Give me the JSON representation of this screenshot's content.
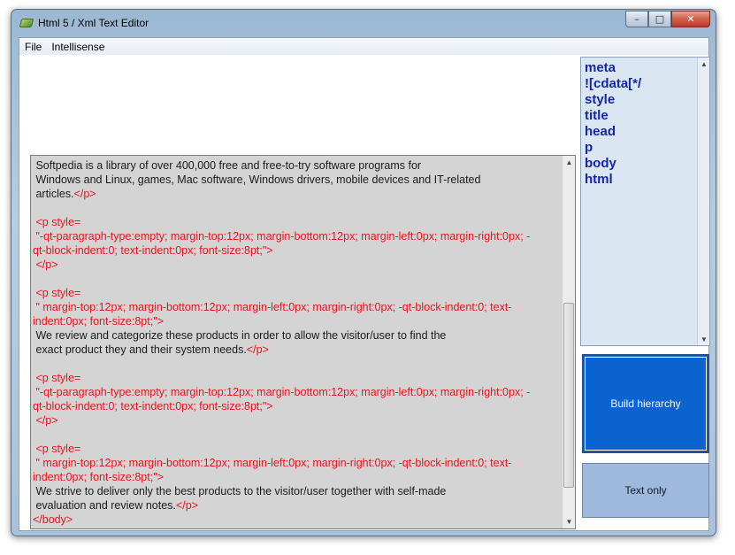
{
  "window": {
    "title": "Html 5 / Xml Text Editor",
    "caption_buttons": {
      "minimize": "–",
      "maximize": "□",
      "close": "✕"
    }
  },
  "menu": [
    "File",
    "Intellisense"
  ],
  "editor": {
    "lines": [
      [
        {
          "t": " Softpedia is a library of over 400,000 free and free-to-try software programs for",
          "c": "blk"
        }
      ],
      [
        {
          "t": " Windows and Linux, games, Mac software, Windows drivers, mobile devices and IT-related",
          "c": "blk"
        }
      ],
      [
        {
          "t": " articles.",
          "c": "blk"
        },
        {
          "t": "</p>",
          "c": "red"
        }
      ],
      [],
      [
        {
          "t": " <p style=",
          "c": "red"
        }
      ],
      [
        {
          "t": " \"-qt-paragraph-type:empty; margin-top:12px; margin-bottom:12px; margin-left:0px; margin-right:0px; -",
          "c": "red"
        }
      ],
      [
        {
          "t": "qt-block-indent:0; text-indent:0px; font-size:8pt;\">",
          "c": "red"
        }
      ],
      [
        {
          "t": " </p>",
          "c": "red"
        }
      ],
      [],
      [
        {
          "t": " <p style=",
          "c": "red"
        }
      ],
      [
        {
          "t": " \" margin-top:12px; margin-bottom:12px; margin-left:0px; margin-right:0px; -qt-block-indent:0; text-",
          "c": "red"
        }
      ],
      [
        {
          "t": "indent:0px; font-size:8pt;\">",
          "c": "red"
        }
      ],
      [
        {
          "t": " We review and categorize these products in order to allow the visitor/user to find the",
          "c": "blk"
        }
      ],
      [
        {
          "t": " exact product they and their system needs.",
          "c": "blk"
        },
        {
          "t": "</p>",
          "c": "red"
        }
      ],
      [],
      [
        {
          "t": " <p style=",
          "c": "red"
        }
      ],
      [
        {
          "t": " \"-qt-paragraph-type:empty; margin-top:12px; margin-bottom:12px; margin-left:0px; margin-right:0px; -",
          "c": "red"
        }
      ],
      [
        {
          "t": "qt-block-indent:0; text-indent:0px; font-size:8pt;\">",
          "c": "red"
        }
      ],
      [
        {
          "t": " </p>",
          "c": "red"
        }
      ],
      [],
      [
        {
          "t": " <p style=",
          "c": "red"
        }
      ],
      [
        {
          "t": " \" margin-top:12px; margin-bottom:12px; margin-left:0px; margin-right:0px; -qt-block-indent:0; text-",
          "c": "red"
        }
      ],
      [
        {
          "t": "indent:0px; font-size:8pt;\">",
          "c": "red"
        }
      ],
      [
        {
          "t": " We strive to deliver only the best products to the visitor/user together with self-made",
          "c": "blk"
        }
      ],
      [
        {
          "t": " evaluation and review notes.",
          "c": "blk"
        },
        {
          "t": "</p>",
          "c": "red"
        }
      ],
      [
        {
          "t": "</body>",
          "c": "red"
        }
      ]
    ]
  },
  "tags": [
    "meta",
    "![cdata[*/",
    "style",
    "title",
    "head",
    "p",
    "body",
    "html"
  ],
  "buttons": {
    "build_hierarchy": "Build hierarchy",
    "text_only": "Text only"
  },
  "icons": {
    "app": "app-icon",
    "scroll_up": "▲",
    "scroll_down": "▼"
  }
}
